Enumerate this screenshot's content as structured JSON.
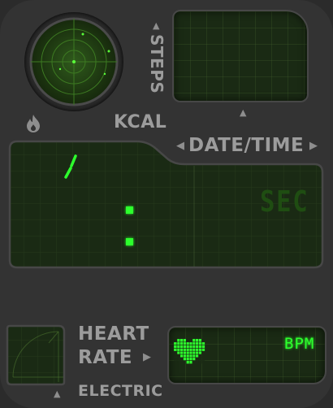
{
  "labels": {
    "steps": "STEPS",
    "kcal": "KCAL",
    "date_time": "DATE/TIME",
    "heart": "HEART",
    "rate": "RATE",
    "electric": "ELECTRIC"
  },
  "main_display": {
    "unit_text": "SEC"
  },
  "heart_display": {
    "unit_text": "BPM"
  },
  "icons": {
    "radar": "radar-icon",
    "flame": "flame-icon",
    "heart": "heart-pixel-icon"
  },
  "colors": {
    "bezel": "#333333",
    "lcd_bg": "#1a2a14",
    "lcd_green": "#2dff2d",
    "dim_green": "#1f4d12",
    "label_gray": "#9c9c9c"
  }
}
